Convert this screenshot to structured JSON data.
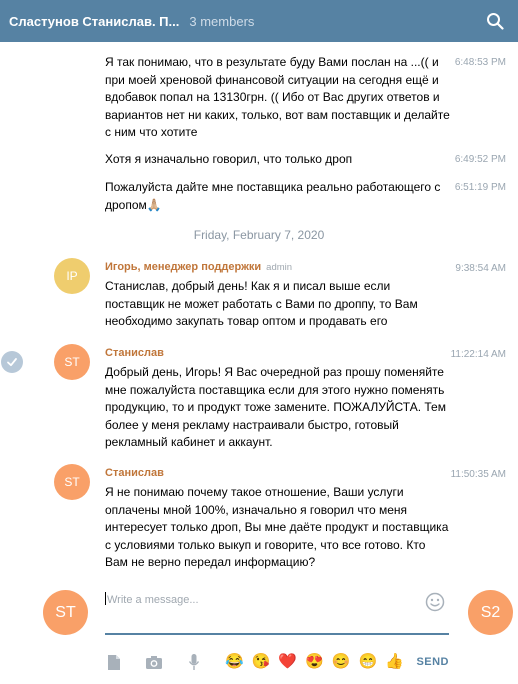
{
  "header": {
    "title": "Сластунов Станислав. П...",
    "members": "3 members",
    "search_icon": "search-icon"
  },
  "messages_top": [
    {
      "text": "Я так понимаю, что в результате буду Вами послан на ...(( и при моей хреновой финансовой ситуации на сегодня ещё и вдобавок попал на 13130грн. (( Ибо от Вас других ответов и вариантов нет ни каких, только, вот вам поставщик и делайте с ним что хотите",
      "time": "6:48:53 PM"
    },
    {
      "text": "Хотя я изначально говорил, что только дроп",
      "time": "6:49:52 PM"
    },
    {
      "text": "Пожалуйста дайте мне поставщика реально работающего с дропом🙏🏼",
      "time": "6:51:19 PM"
    }
  ],
  "date_separator": "Friday, February 7, 2020",
  "messages": [
    {
      "avatar": "IP",
      "author": "Игорь, менеджер поддержки",
      "badge": "admin",
      "time": "9:38:54 AM",
      "text": "Станислав, добрый день! Как я и писал выше если поставщик не может работать с Вами по дроппу, то Вам необходимо закупать товар оптом и продавать его"
    },
    {
      "avatar": "ST",
      "author": "Станислав",
      "badge": "",
      "time": "11:22:14 AM",
      "text": "Добрый день, Игорь! Я Вас очередной раз прошу поменяйте мне пожалуйста поставщика если для этого нужно поменять продукцию, то и продукт тоже замените. ПОЖАЛУЙСТА. Тем более у меня рекламу настраивали быстро, готовый рекламный кабинет и аккаунт."
    },
    {
      "avatar": "ST",
      "author": "Станислав",
      "badge": "",
      "time": "11:50:35 AM",
      "text": "Я не понимаю почему такое отношение, Ваши услуги оплачены мной 100%, изначально я говорил что меня интересует только дроп, Вы мне даёте продукт и поставщика с условиями только выкуп и говорите, что все готово. Кто Вам не верно передал информацию?"
    }
  ],
  "composer": {
    "my_avatar": "ST",
    "peer_avatar": "S2",
    "placeholder": "Write a message...",
    "send_label": "SEND",
    "emoji_bar": [
      "😂",
      "😘",
      "❤️",
      "😍",
      "😊",
      "😁",
      "👍"
    ]
  },
  "colors": {
    "header": "#5682a3",
    "author": "#c0763a",
    "avatar_ip": "#efcd6e",
    "avatar_st": "#f9a068"
  }
}
